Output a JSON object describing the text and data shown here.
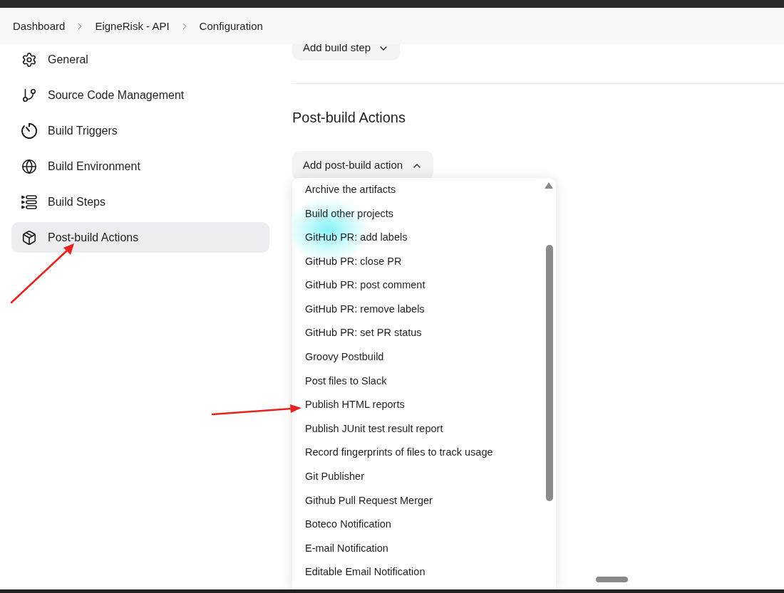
{
  "breadcrumbs": [
    {
      "label": "Dashboard"
    },
    {
      "label": "EigneRisk - API"
    },
    {
      "label": "Configuration"
    }
  ],
  "sidebar": {
    "items": [
      {
        "label": "General",
        "selected": false
      },
      {
        "label": "Source Code Management",
        "selected": false
      },
      {
        "label": "Build Triggers",
        "selected": false
      },
      {
        "label": "Build Environment",
        "selected": false
      },
      {
        "label": "Build Steps",
        "selected": false
      },
      {
        "label": "Post-build Actions",
        "selected": true
      }
    ]
  },
  "build_steps": {
    "add_button": {
      "label": "Add build step",
      "expanded": false
    }
  },
  "post_build": {
    "title": "Post-build Actions",
    "add_button": {
      "label": "Add post-build action",
      "expanded": true
    },
    "menu": {
      "items": [
        "Archive the artifacts",
        "Build other projects",
        "GitHub PR: add labels",
        "GitHub PR: close PR",
        "GitHub PR: post comment",
        "GitHub PR: remove labels",
        "GitHub PR: set PR status",
        "Groovy Postbuild",
        "Post files to Slack",
        "Publish HTML reports",
        "Publish JUnit test result report",
        "Record fingerprints of files to track usage",
        "Git Publisher",
        "Github Pull Request Merger",
        "Boteco Notification",
        "E-mail Notification",
        "Editable Email Notification"
      ]
    }
  }
}
